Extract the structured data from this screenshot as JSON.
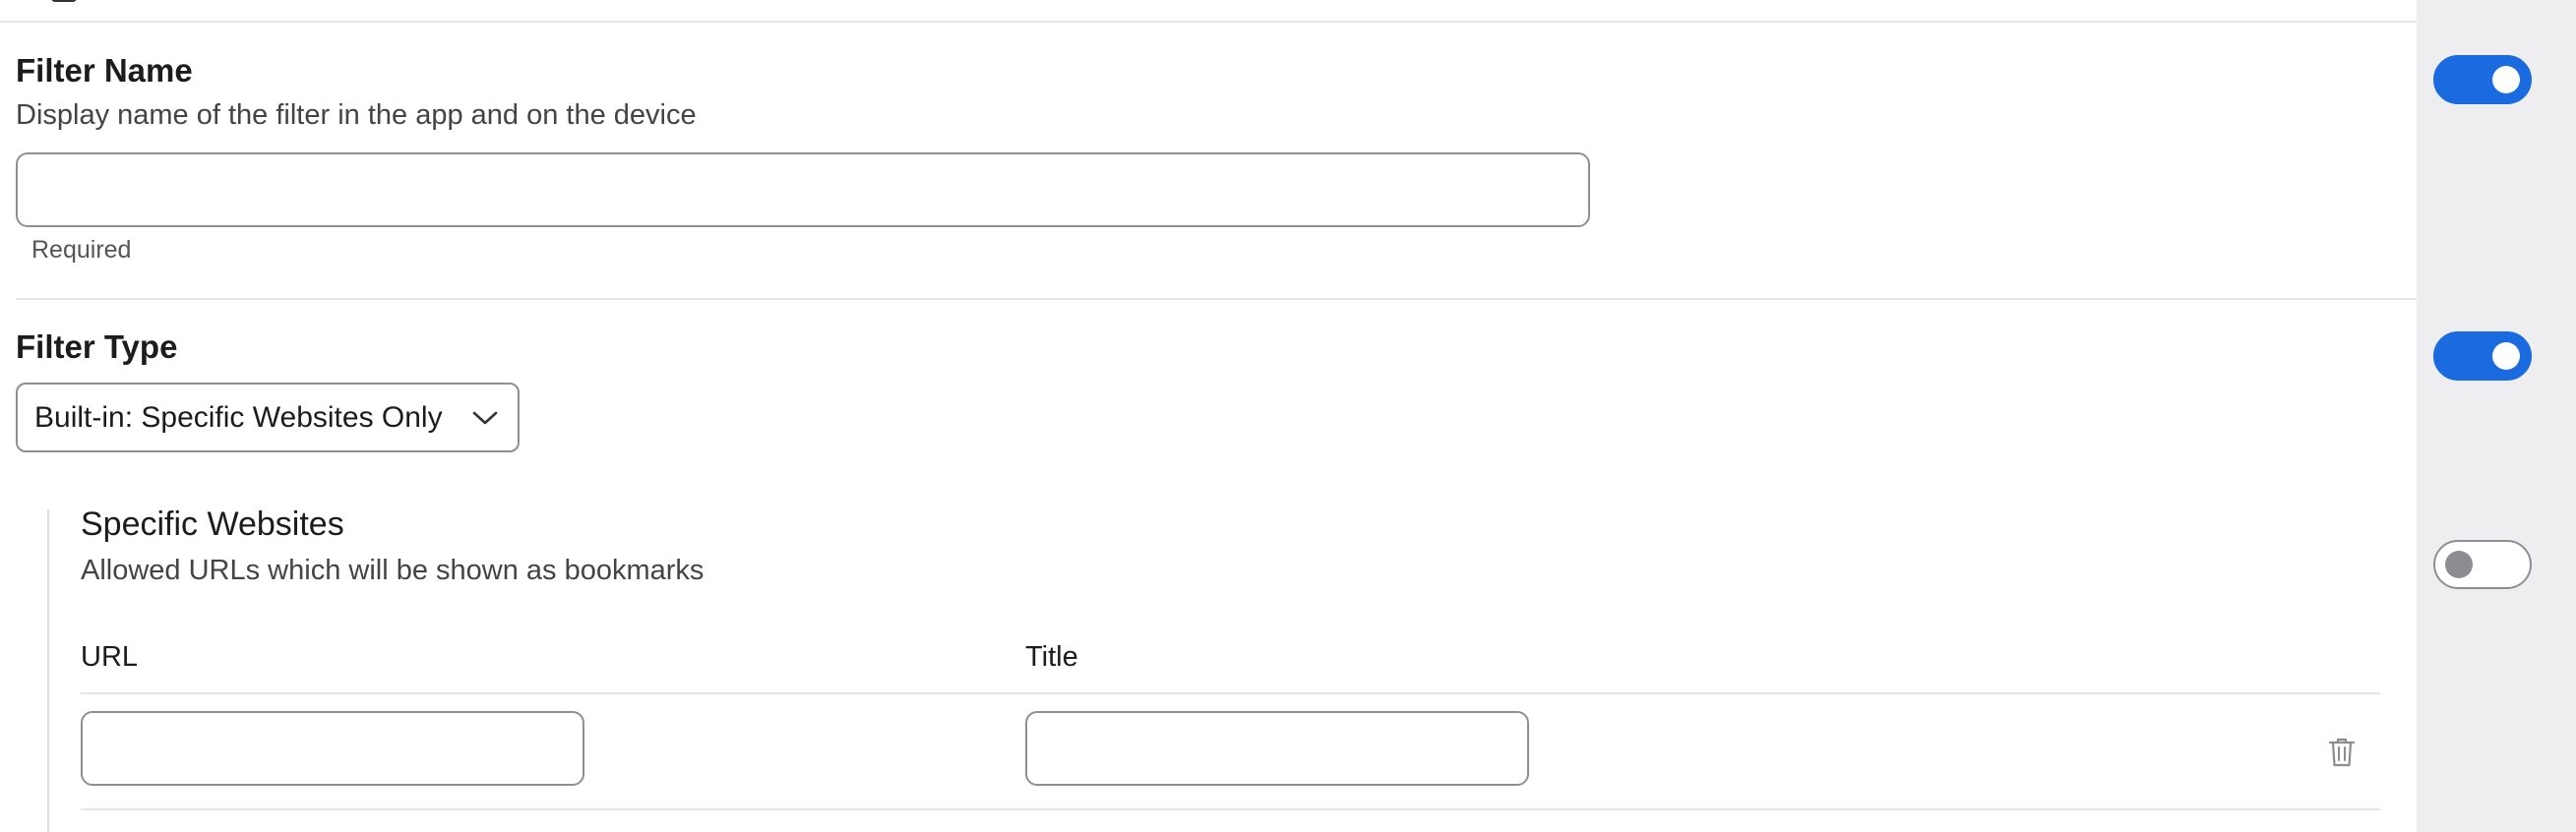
{
  "filter_name": {
    "title": "Filter Name",
    "description": "Display name of the filter in the app and on the device",
    "value": "",
    "helper": "Required",
    "toggle_on": true
  },
  "filter_type": {
    "title": "Filter Type",
    "selected": "Built-in: Specific Websites Only",
    "toggle_on": true
  },
  "specific_websites": {
    "title": "Specific Websites",
    "description": "Allowed URLs which will be shown as bookmarks",
    "toggle_on": false,
    "columns": [
      "URL",
      "Title"
    ],
    "rows": [
      {
        "url": "",
        "title": ""
      }
    ]
  },
  "icons": {
    "delete": "trash-icon",
    "select": "chevron-down-icon"
  },
  "colors": {
    "accent": "#1a6ae0",
    "side_column": "#eeeef0",
    "divider": "#e4e4e6"
  }
}
